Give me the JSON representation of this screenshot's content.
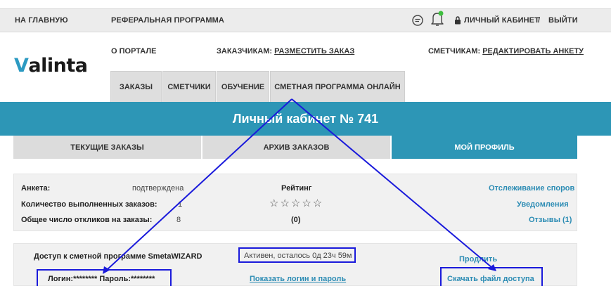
{
  "topbar": {
    "home": "НА ГЛАВНУЮ",
    "referral": "РЕФЕРАЛЬНАЯ ПРОГРАММА",
    "cabinet": "ЛИЧНЫЙ КАБИНЕТ",
    "separator": "/",
    "logout": "ВЫЙТИ"
  },
  "logo": {
    "v": "V",
    "rest": "alinta"
  },
  "nav": {
    "about": "О ПОРТАЛЕ",
    "customers_prefix": "ЗАКАЗЧИКАМ: ",
    "customers_link": "РАЗМЕСТИТЬ ЗАКАЗ",
    "estimators_prefix": "СМЕТЧИКАМ: ",
    "estimators_link": "РЕДАКТИРОВАТЬ АНКЕТУ"
  },
  "tabs": [
    "ЗАКАЗЫ",
    "СМЕТЧИКИ",
    "ОБУЧЕНИЕ",
    "СМЕТНАЯ ПРОГРАММА ОНЛАЙН"
  ],
  "banner": {
    "title": "Личный кабинет № 741"
  },
  "subtabs": [
    "ТЕКУЩИЕ ЗАКАЗЫ",
    "АРХИВ ЗАКАЗОВ",
    "МОЙ ПРОФИЛЬ"
  ],
  "profile": {
    "anketa_label": "Анкета:",
    "anketa_value": "подтверждена",
    "orders_label": "Количество выполненных заказов:",
    "orders_value": "1",
    "responses_label": "Общее число откликов на заказы:",
    "responses_value": "8",
    "rating_label": "Рейтинг",
    "rating_stars": "☆☆☆☆☆",
    "rating_count": "(0)",
    "disputes": "Отслеживание споров",
    "notifications": "Уведомления",
    "reviews": "Отзывы (1)"
  },
  "access": {
    "title": "Доступ к сметной программе SmetaWIZARD",
    "status": "Активен, осталось 0д 23ч 59м",
    "extend": "Продлить",
    "login_label": "Логин:",
    "login_value": "********",
    "password_label": " Пароль:",
    "password_value": "********",
    "show_credentials": "Показать логин и пароль",
    "download": "Скачать файл доступа"
  },
  "colors": {
    "accent": "#2d96b6",
    "link": "#2c8cb4",
    "annotation": "#1a1adb",
    "notify_dot": "#3fbf3f"
  },
  "icons": [
    "chat-icon",
    "bell-icon",
    "lock-icon"
  ]
}
